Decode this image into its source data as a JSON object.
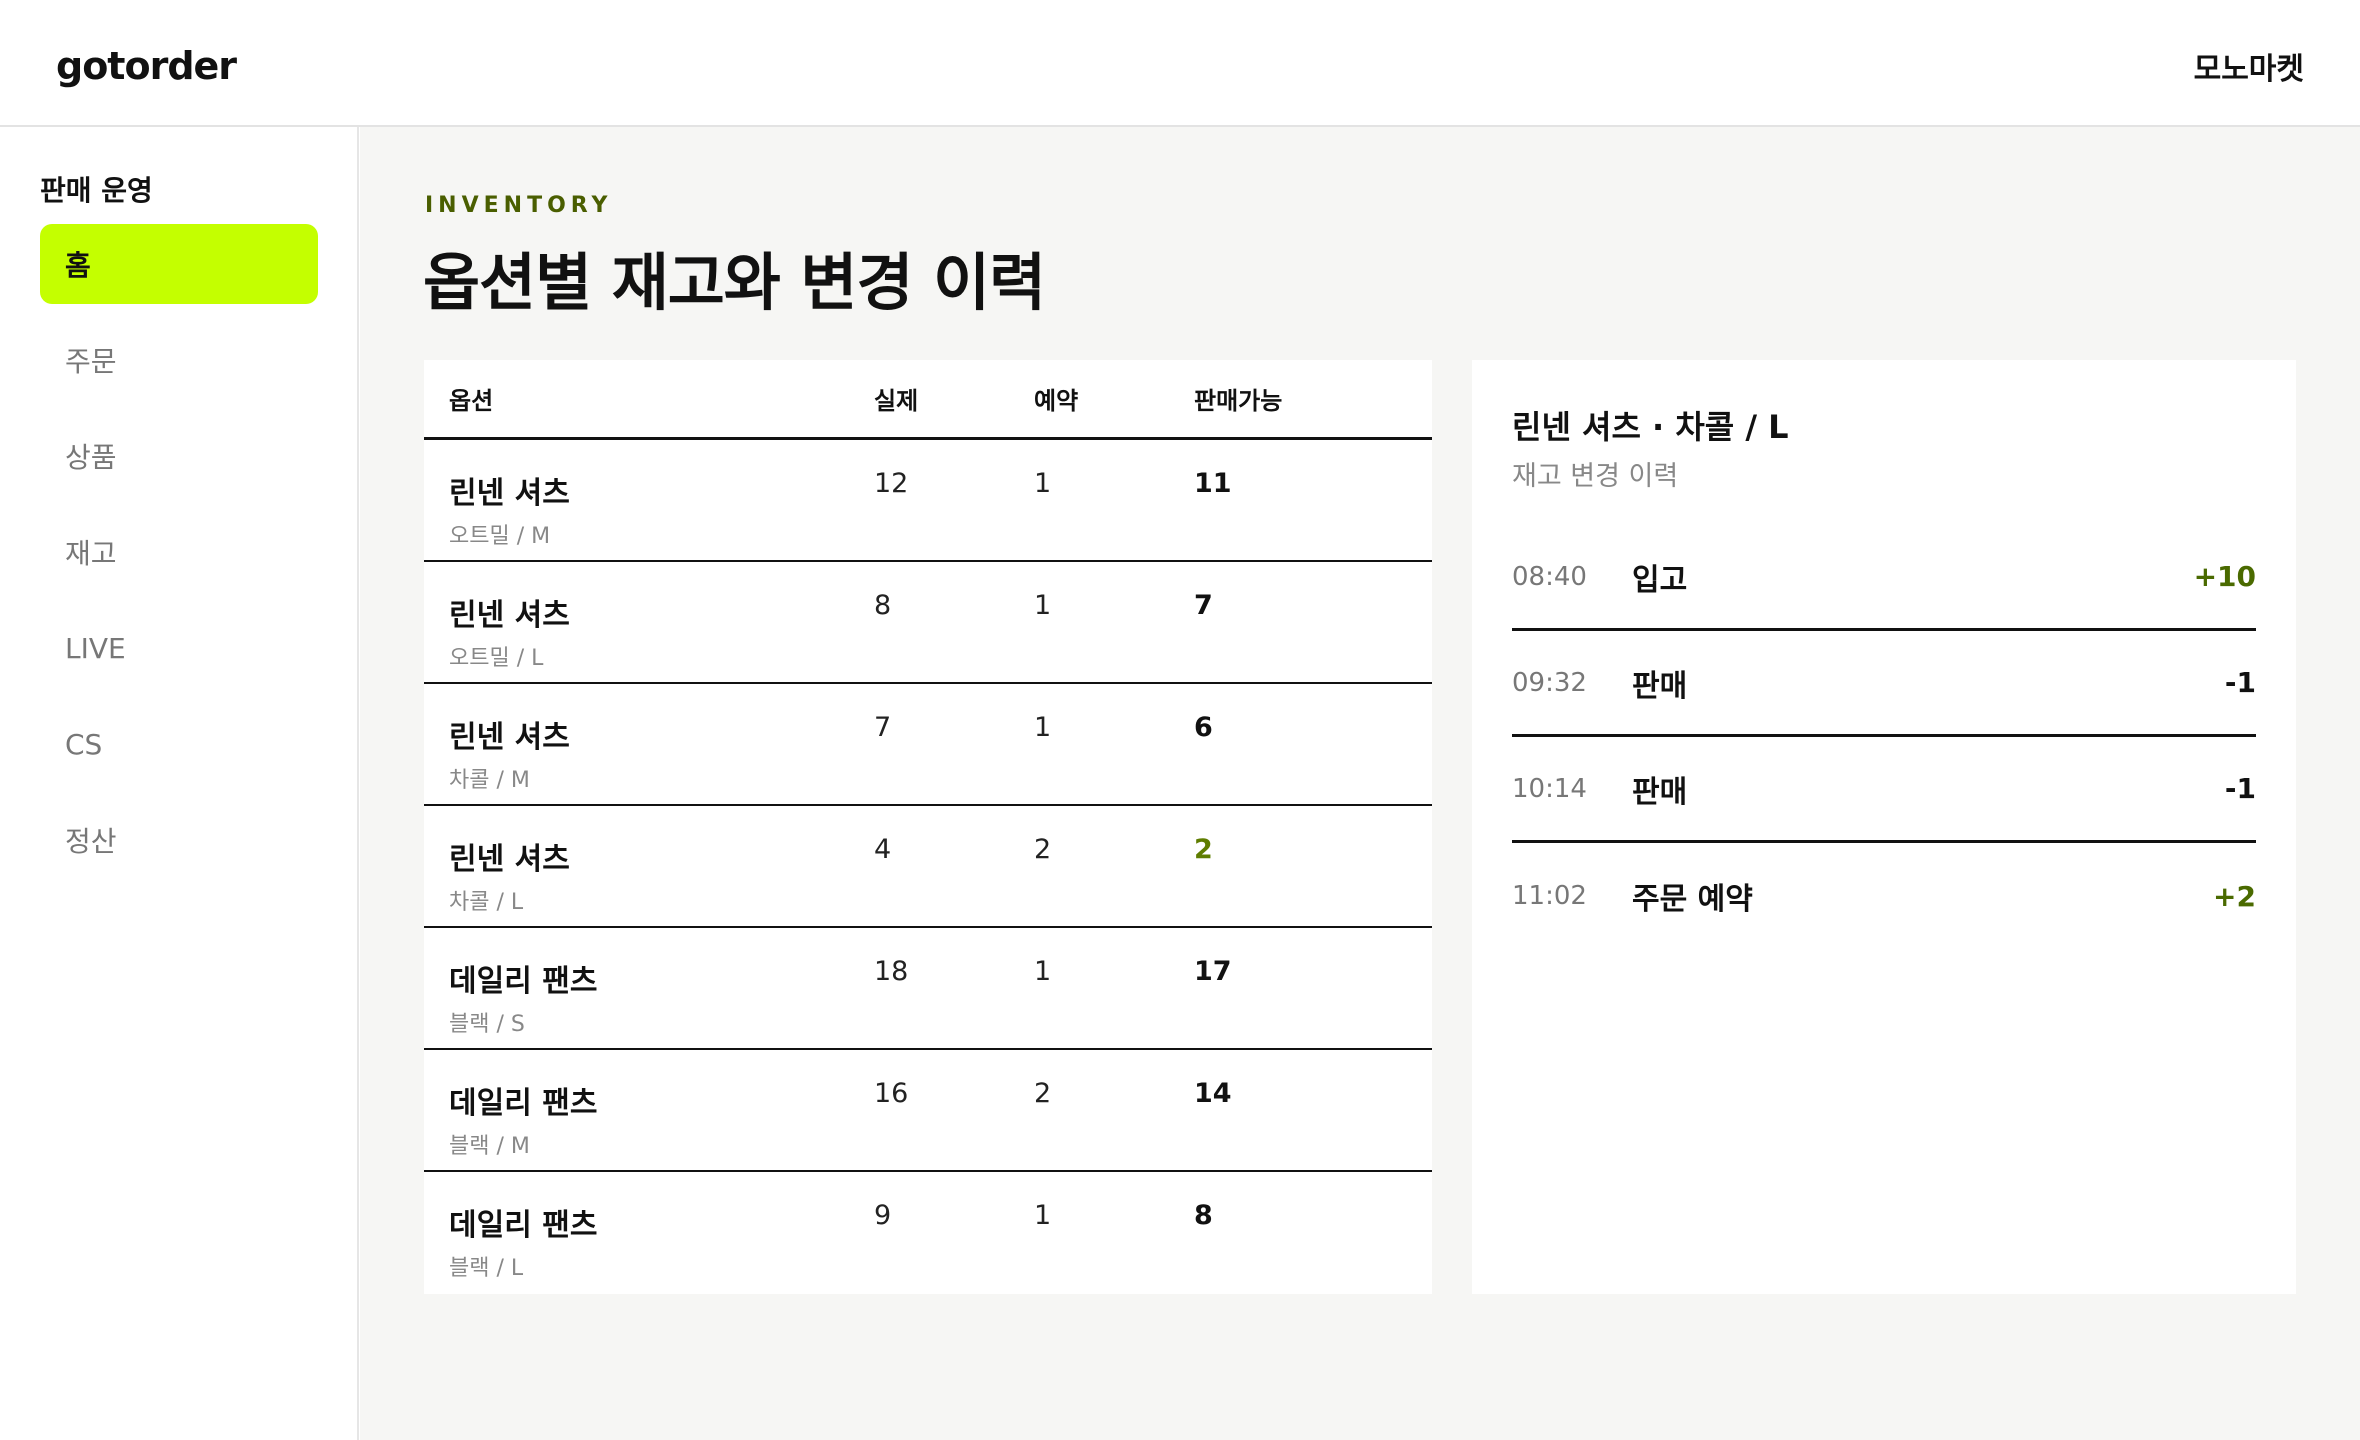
{
  "header": {
    "logo": "gotorder",
    "store_name": "모노마켓"
  },
  "sidebar": {
    "section_title": "판매 운영",
    "items": [
      {
        "label": "홈",
        "active": true
      },
      {
        "label": "주문"
      },
      {
        "label": "상품"
      },
      {
        "label": "재고"
      },
      {
        "label": "LIVE"
      },
      {
        "label": "CS"
      },
      {
        "label": "정산"
      }
    ]
  },
  "page": {
    "eyebrow": "INVENTORY",
    "title": "옵션별 재고와 변경 이력"
  },
  "table": {
    "columns": [
      "옵션",
      "실제",
      "예약",
      "판매가능"
    ],
    "rows": [
      {
        "name": "린넨 셔츠",
        "variant": "오트밀 / M",
        "actual": "12",
        "reserved": "1",
        "available": "11"
      },
      {
        "name": "린넨 셔츠",
        "variant": "오트밀 / L",
        "actual": "8",
        "reserved": "1",
        "available": "7"
      },
      {
        "name": "린넨 셔츠",
        "variant": "차콜 / M",
        "actual": "7",
        "reserved": "1",
        "available": "6"
      },
      {
        "name": "린넨 셔츠",
        "variant": "차콜 / L",
        "actual": "4",
        "reserved": "2",
        "available": "2",
        "low": true
      },
      {
        "name": "데일리 팬츠",
        "variant": "블랙 / S",
        "actual": "18",
        "reserved": "1",
        "available": "17"
      },
      {
        "name": "데일리 팬츠",
        "variant": "블랙 / M",
        "actual": "16",
        "reserved": "2",
        "available": "14"
      },
      {
        "name": "데일리 팬츠",
        "variant": "블랙 / L",
        "actual": "9",
        "reserved": "1",
        "available": "8"
      }
    ]
  },
  "history": {
    "title": "린넨 셔츠 · 차콜 / L",
    "subtitle": "재고 변경 이력",
    "entries": [
      {
        "time": "08:40",
        "type": "입고",
        "delta": "+10",
        "positive": true
      },
      {
        "time": "09:32",
        "type": "판매",
        "delta": "-1"
      },
      {
        "time": "10:14",
        "type": "판매",
        "delta": "-1"
      },
      {
        "time": "11:02",
        "type": "주문 예약",
        "delta": "+2",
        "positive": true
      }
    ]
  },
  "colors": {
    "accent": "#c4ff00",
    "positive": "#4a6a00",
    "eyebrow": "#4a5e00"
  }
}
